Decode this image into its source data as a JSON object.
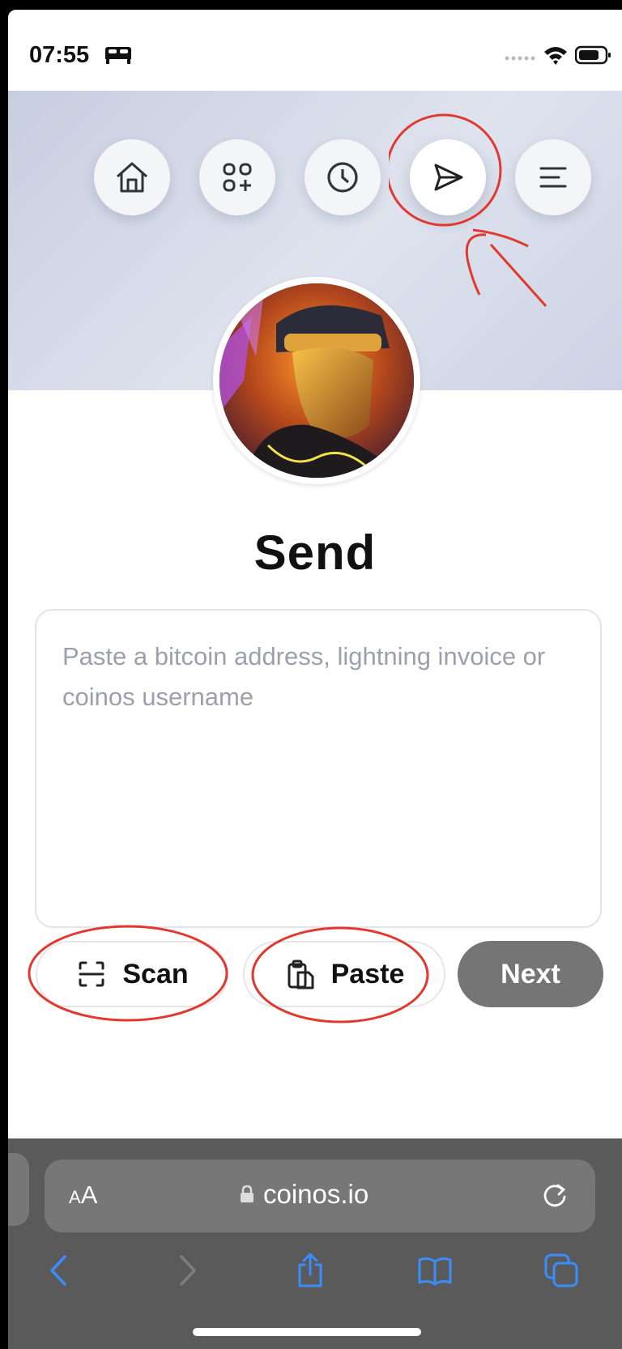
{
  "status_bar": {
    "time": "07:55"
  },
  "nav": [
    {
      "name": "home",
      "icon": "home-icon"
    },
    {
      "name": "apps",
      "icon": "apps-plus-icon"
    },
    {
      "name": "history",
      "icon": "clock-icon"
    },
    {
      "name": "send",
      "icon": "send-icon",
      "active": true
    },
    {
      "name": "menu",
      "icon": "menu-icon"
    }
  ],
  "page": {
    "title": "Send",
    "input_placeholder": "Paste a bitcoin address, lightning invoice or coinos username",
    "input_value": ""
  },
  "actions": {
    "scan_label": "Scan",
    "paste_label": "Paste",
    "next_label": "Next"
  },
  "browser": {
    "text_size_label_small": "A",
    "text_size_label_large": "A",
    "domain": "coinos.io"
  },
  "colors": {
    "annotation": "#e0392f",
    "next_button": "#757575",
    "browser_chrome": "#5a5a5a",
    "toolbar_icon": "#3a8dff"
  }
}
